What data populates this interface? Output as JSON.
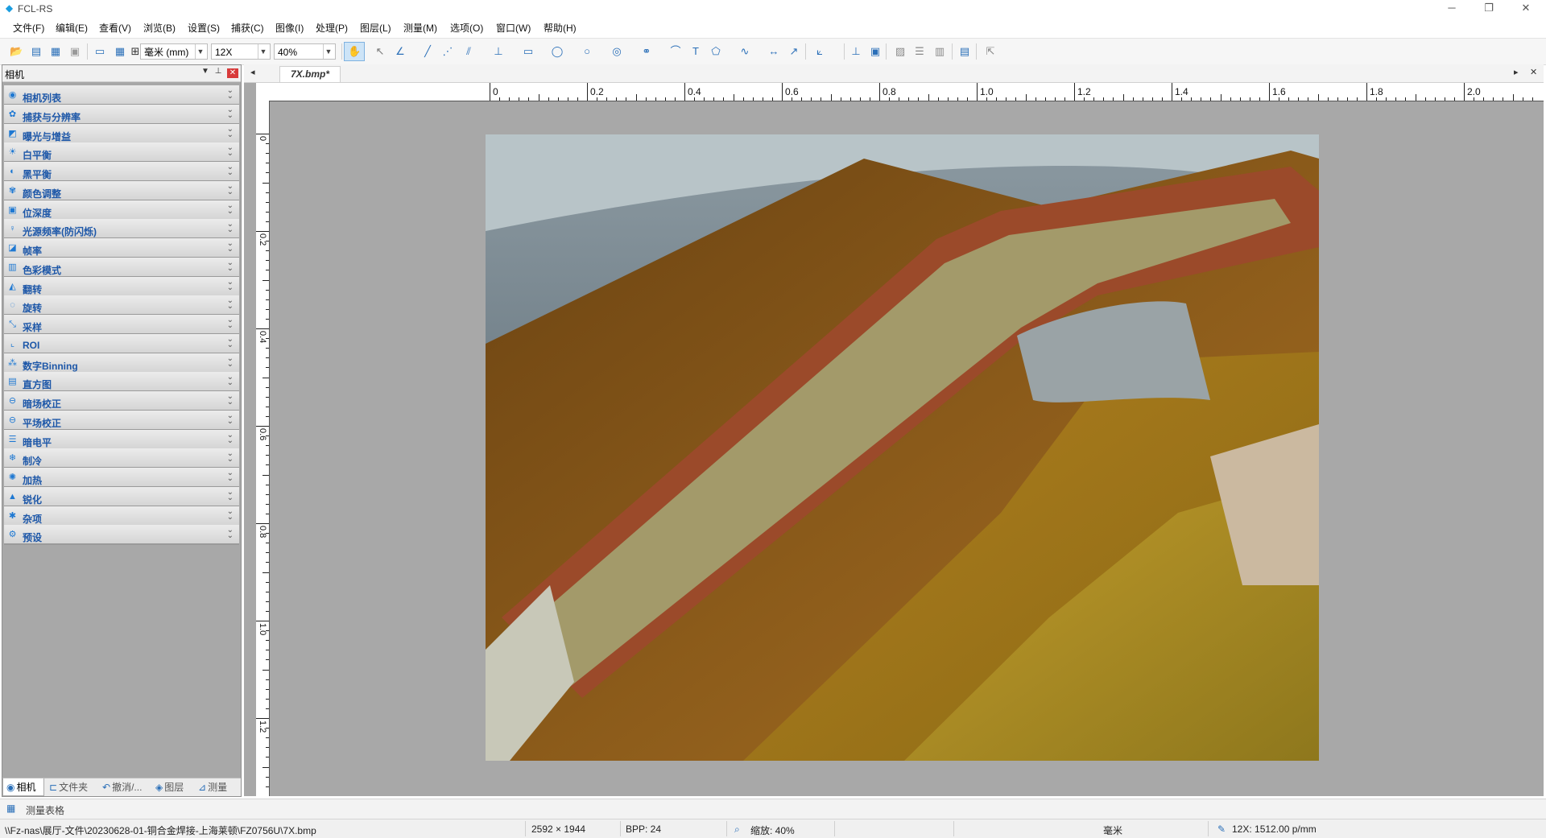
{
  "window": {
    "title": "FCL-RS"
  },
  "menu": [
    "文件(F)",
    "编辑(E)",
    "查看(V)",
    "浏览(B)",
    "设置(S)",
    "捕获(C)",
    "图像(I)",
    "处理(P)",
    "图层(L)",
    "测量(M)",
    "选项(O)",
    "窗口(W)",
    "帮助(H)"
  ],
  "toolbar": {
    "unit": "毫米 (mm)",
    "magnification": "12X",
    "zoom": "40%"
  },
  "left_panel": {
    "title": "相机",
    "items": [
      {
        "label": "相机列表",
        "icon": "camera-icon"
      },
      {
        "label": "捕获与分辨率",
        "icon": "capture-icon"
      },
      {
        "label": "曝光与增益",
        "icon": "exposure-icon"
      },
      {
        "label": "白平衡",
        "icon": "sun-icon"
      },
      {
        "label": "黑平衡",
        "icon": "contrast-icon"
      },
      {
        "label": "颜色调整",
        "icon": "palette-icon"
      },
      {
        "label": "位深度",
        "icon": "bit-depth-icon"
      },
      {
        "label": "光源频率(防闪烁)",
        "icon": "bulb-icon"
      },
      {
        "label": "帧率",
        "icon": "frame-rate-icon"
      },
      {
        "label": "色彩模式",
        "icon": "color-mode-icon"
      },
      {
        "label": "翻转",
        "icon": "flip-icon"
      },
      {
        "label": "旋转",
        "icon": "rotate-icon"
      },
      {
        "label": "采样",
        "icon": "sampling-icon"
      },
      {
        "label": "ROI",
        "icon": "roi-icon"
      },
      {
        "label": "数字Binning",
        "icon": "binning-icon"
      },
      {
        "label": "直方图",
        "icon": "histogram-icon"
      },
      {
        "label": "暗场校正",
        "icon": "dark-field-icon"
      },
      {
        "label": "平场校正",
        "icon": "flat-field-icon"
      },
      {
        "label": "暗电平",
        "icon": "dark-level-icon"
      },
      {
        "label": "制冷",
        "icon": "snowflake-icon"
      },
      {
        "label": "加热",
        "icon": "heat-icon"
      },
      {
        "label": "锐化",
        "icon": "sharpen-icon"
      },
      {
        "label": "杂项",
        "icon": "misc-icon"
      },
      {
        "label": "预设",
        "icon": "preset-icon"
      }
    ],
    "tabs": [
      {
        "label": "相机",
        "icon": "camera-icon"
      },
      {
        "label": "文件夹",
        "icon": "folder-icon"
      },
      {
        "label": "撤消/...",
        "icon": "undo-icon"
      },
      {
        "label": "图层",
        "icon": "layers-icon"
      },
      {
        "label": "测量",
        "icon": "measure-icon"
      }
    ]
  },
  "document": {
    "tab_label": "7X.bmp*",
    "ruler_top": [
      "0",
      "0.2",
      "0.4",
      "0.6",
      "0.8",
      "1.0",
      "1.2",
      "1.4",
      "1.6",
      "1.8",
      "2.0"
    ],
    "ruler_left": [
      "0",
      "0.2",
      "0.4",
      "0.6",
      "0.8",
      "1.0",
      "1.2"
    ]
  },
  "measure_bar": {
    "label": "测量表格"
  },
  "status": {
    "path": "\\\\Fz-nas\\展厅-文件\\20230628-01-铜合金焊接-上海莱顿\\FZ0756U\\7X.bmp",
    "dimensions": "2592 × 1944",
    "bpp": "BPP: 24",
    "zoom": "缩放: 40%",
    "unit": "毫米",
    "calibration": "12X: 1512.00 p/mm"
  }
}
